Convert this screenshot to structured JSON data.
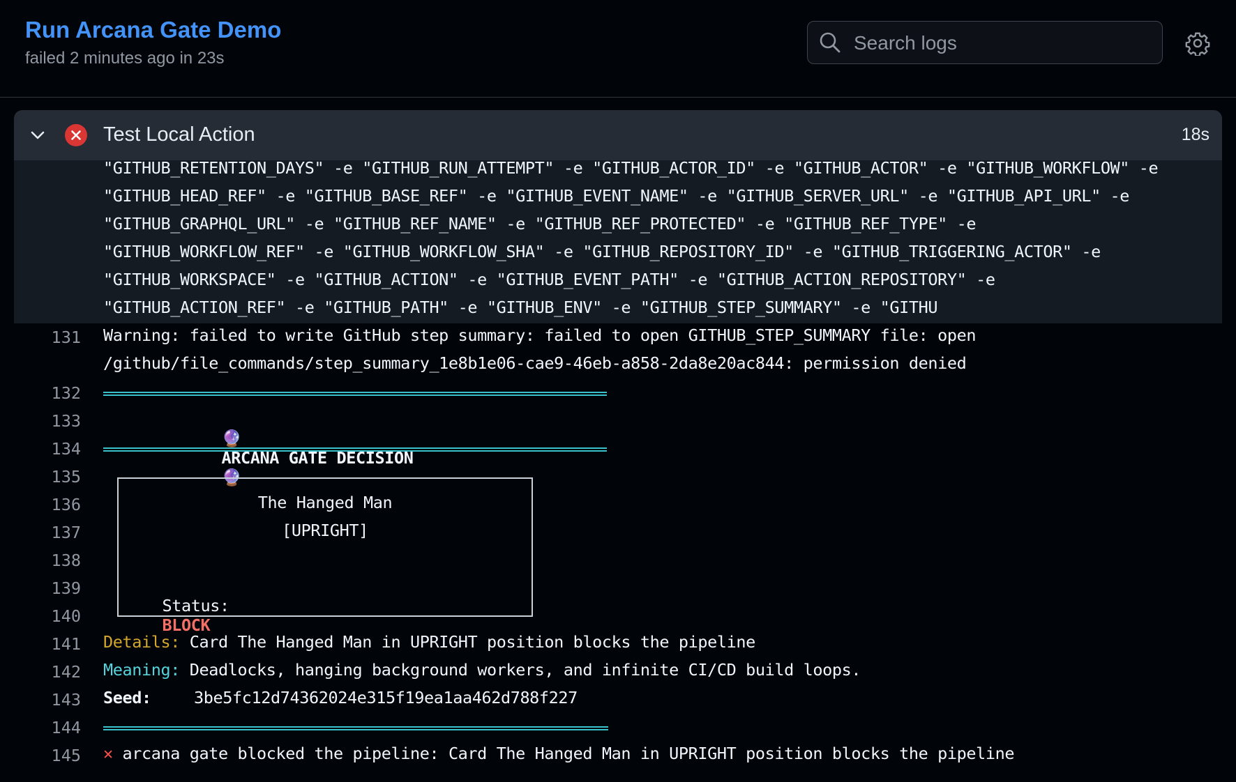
{
  "header": {
    "title": "Run Arcana Gate Demo",
    "subtitle": "failed 2 minutes ago in 23s",
    "search_placeholder": "Search logs"
  },
  "step": {
    "name": "Test Local Action",
    "duration": "18s",
    "status": "failed"
  },
  "continuation_lines": [
    "\"GITHUB_RETENTION_DAYS\" -e \"GITHUB_RUN_ATTEMPT\" -e \"GITHUB_ACTOR_ID\" -e \"GITHUB_ACTOR\" -e \"GITHUB_WORKFLOW\" -e",
    "\"GITHUB_HEAD_REF\" -e \"GITHUB_BASE_REF\" -e \"GITHUB_EVENT_NAME\" -e \"GITHUB_SERVER_URL\" -e \"GITHUB_API_URL\" -e",
    "\"GITHUB_GRAPHQL_URL\" -e \"GITHUB_REF_NAME\" -e \"GITHUB_REF_PROTECTED\" -e \"GITHUB_REF_TYPE\" -e",
    "\"GITHUB_WORKFLOW_REF\" -e \"GITHUB_WORKFLOW_SHA\" -e \"GITHUB_REPOSITORY_ID\" -e \"GITHUB_TRIGGERING_ACTOR\" -e",
    "\"GITHUB_WORKSPACE\" -e \"GITHUB_ACTION\" -e \"GITHUB_EVENT_PATH\" -e \"GITHUB_ACTION_REPOSITORY\" -e",
    "\"GITHUB_ACTION_REF\" -e \"GITHUB_PATH\" -e \"GITHUB_ENV\" -e \"GITHUB_STEP_SUMMARY\" -e \"GITHU"
  ],
  "lines": {
    "l131": {
      "num": "131",
      "text": "Warning: failed to write GitHub step summary: failed to open GITHUB_STEP_SUMMARY file: open",
      "wrap": "/github/file_commands/step_summary_1e8b1e06-cae9-46eb-a858-2da8e20ac844: permission denied"
    },
    "l132": {
      "num": "132"
    },
    "l133": {
      "num": "133",
      "text": "ARCANA GATE DECISION",
      "emoji": "🔮"
    },
    "l134": {
      "num": "134"
    },
    "l135": {
      "num": "135"
    },
    "l136": {
      "num": "136",
      "text": "The Hanged Man"
    },
    "l137": {
      "num": "137",
      "text": "[UPRIGHT]"
    },
    "l138": {
      "num": "138"
    },
    "l139": {
      "num": "139",
      "label": "Status:",
      "value": "BLOCK"
    },
    "l140": {
      "num": "140"
    },
    "l141": {
      "num": "141",
      "label": "Details:",
      "text": "Card The Hanged Man in UPRIGHT position blocks the pipeline"
    },
    "l142": {
      "num": "142",
      "label": "Meaning:",
      "text": "Deadlocks, hanging background workers, and infinite CI/CD build loops."
    },
    "l143": {
      "num": "143",
      "label": "Seed:",
      "text": "3be5fc12d74362024e315f19ea1aa462d788f227"
    },
    "l144": {
      "num": "144"
    },
    "l145": {
      "num": "145",
      "text": "arcana gate blocked the pipeline: Card The Hanged Man in UPRIGHT position blocks the pipeline"
    }
  },
  "colors": {
    "accent": "#4493f8",
    "fail": "#da3633",
    "rule": "#3bc1cc",
    "details_label": "#d4a72c",
    "meaning_label": "#56d4dd",
    "block": "#f47067"
  },
  "icons": [
    "search-icon",
    "gear-icon",
    "chevron-down-icon",
    "failure-x-icon",
    "crystal-ball-icon",
    "red-x-icon"
  ]
}
